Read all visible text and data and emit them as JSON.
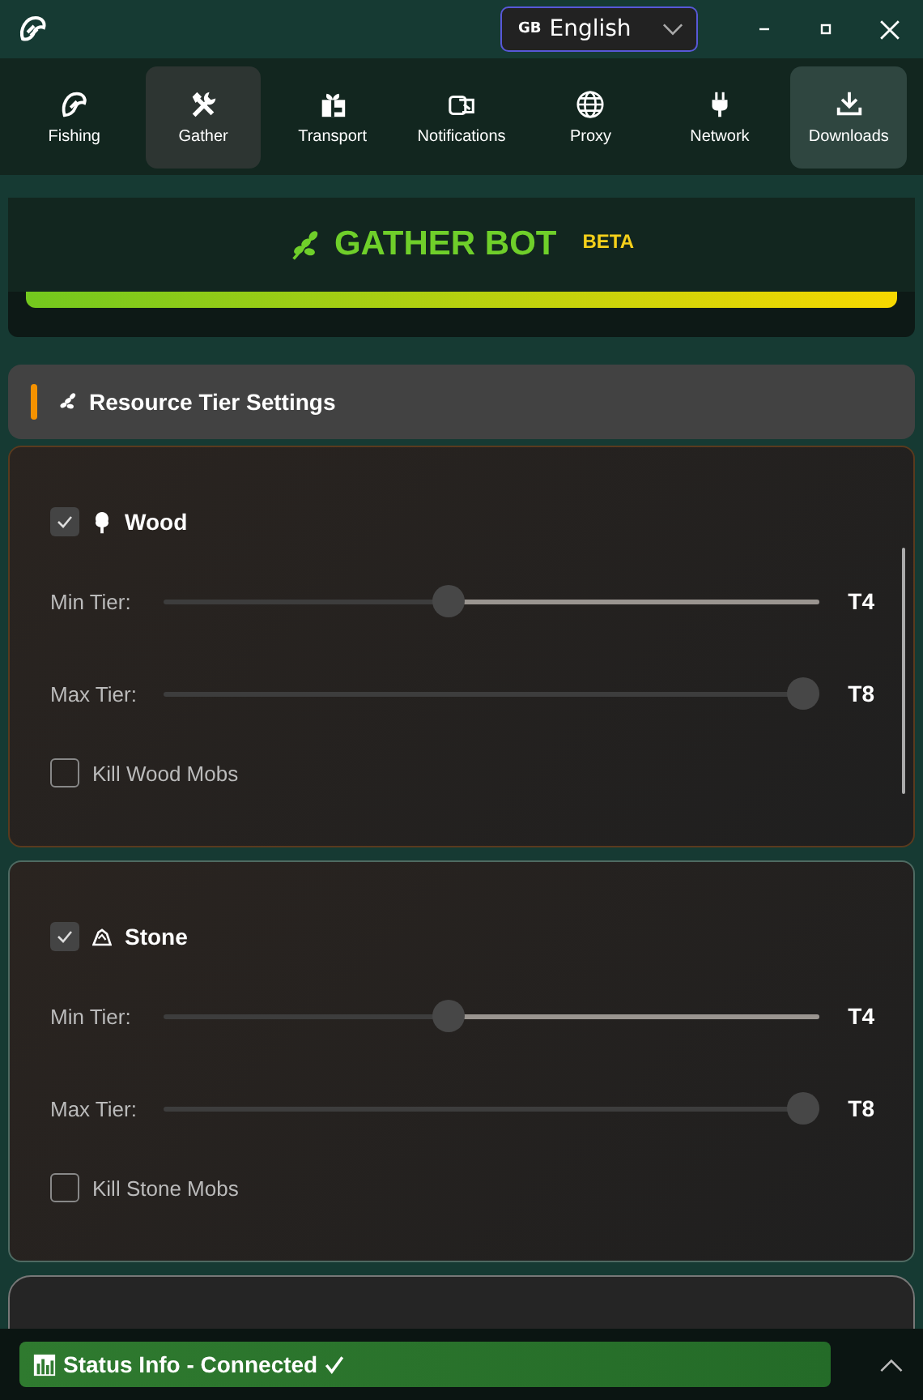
{
  "language_select": {
    "flag": "GB",
    "value": "English"
  },
  "tabs": [
    {
      "label": "Fishing",
      "selected": false,
      "hovered": false
    },
    {
      "label": "Gather",
      "selected": true,
      "hovered": false
    },
    {
      "label": "Transport",
      "selected": false,
      "hovered": false
    },
    {
      "label": "Notifications",
      "selected": false,
      "hovered": false
    },
    {
      "label": "Proxy",
      "selected": false,
      "hovered": false
    },
    {
      "label": "Network",
      "selected": false,
      "hovered": false
    },
    {
      "label": "Downloads",
      "selected": false,
      "hovered": true
    }
  ],
  "banner": {
    "title": "GATHER BOT",
    "badge": "BETA"
  },
  "section": {
    "title": "Resource Tier Settings"
  },
  "resources": [
    {
      "name": "Wood",
      "checked": true,
      "sliders": [
        {
          "label": "Min Tier:",
          "level": 0.43,
          "reading": "T4"
        },
        {
          "label": "Max Tier:",
          "level": 1,
          "reading": "T8"
        }
      ],
      "mobs": {
        "label": "Kill Wood Mobs",
        "checked": false
      }
    },
    {
      "name": "Stone",
      "checked": true,
      "sliders": [
        {
          "label": "Min Tier:",
          "level": 0.43,
          "reading": "T4"
        },
        {
          "label": "Max Tier:",
          "level": 1,
          "reading": "T8"
        }
      ],
      "mobs": {
        "label": "Kill Stone Mobs",
        "checked": false
      }
    }
  ],
  "status": {
    "label": "Status Info - Connected",
    "connected": true
  }
}
